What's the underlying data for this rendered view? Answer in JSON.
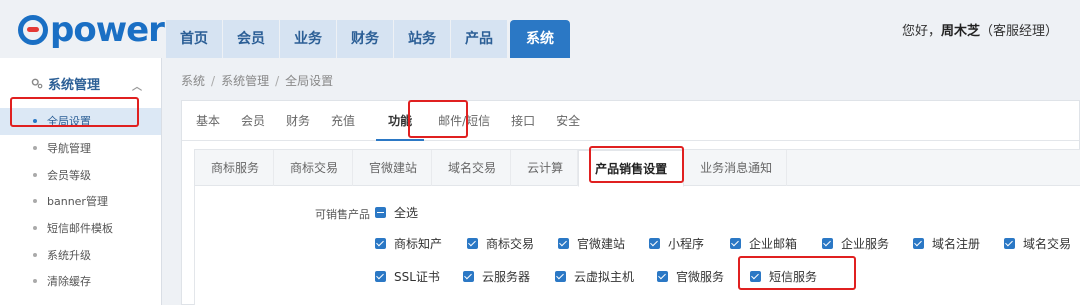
{
  "logo": {
    "text": "power"
  },
  "topnav": [
    "首页",
    "会员",
    "业务",
    "财务",
    "站务",
    "产品",
    "系统"
  ],
  "user": {
    "greeting": "您好，",
    "name": "周木芝",
    "role": "（客服经理）"
  },
  "sidebar": {
    "title": "系统管理",
    "items": [
      "全局设置",
      "导航管理",
      "会员等级",
      "banner管理",
      "短信邮件模板",
      "系统升级",
      "清除缓存"
    ]
  },
  "breadcrumb": [
    "系统",
    "系统管理",
    "全局设置"
  ],
  "tabs1": [
    "基本",
    "会员",
    "财务",
    "充值",
    "功能",
    "邮件/短信",
    "接口",
    "安全"
  ],
  "tabs2": [
    "商标服务",
    "商标交易",
    "官微建站",
    "域名交易",
    "云计算",
    "产品销售设置",
    "业务消息通知"
  ],
  "form": {
    "label": "可销售产品",
    "select_all": "全选",
    "options_row1": [
      "商标知产",
      "商标交易",
      "官微建站",
      "小程序",
      "企业邮箱",
      "企业服务",
      "域名注册",
      "域名交易"
    ],
    "options_row2": [
      "SSL证书",
      "云服务器",
      "云虚拟主机",
      "官微服务",
      "短信服务"
    ]
  },
  "colors": {
    "accent": "#2b78c5",
    "highlight": "#e02020"
  }
}
